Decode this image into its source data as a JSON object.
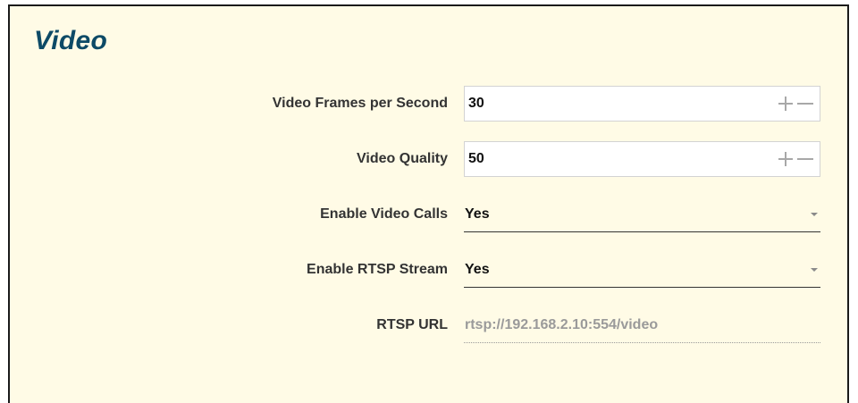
{
  "section": {
    "title": "Video"
  },
  "fields": {
    "fps": {
      "label": "Video Frames per Second",
      "value": "30"
    },
    "quality": {
      "label": "Video Quality",
      "value": "50"
    },
    "video_calls": {
      "label": "Enable Video Calls",
      "value": "Yes"
    },
    "rtsp_stream": {
      "label": "Enable RTSP Stream",
      "value": "Yes"
    },
    "rtsp_url": {
      "label": "RTSP URL",
      "value": "rtsp://192.168.2.10:554/video"
    }
  },
  "icons": {
    "increment": "plus-icon",
    "decrement": "minus-icon",
    "dropdown": "caret-down-icon"
  },
  "colors": {
    "panel_background": "#fffbe6",
    "title": "#0d4a66",
    "label": "#333333",
    "value": "#111111",
    "readonly_value": "#9a9a9a"
  }
}
